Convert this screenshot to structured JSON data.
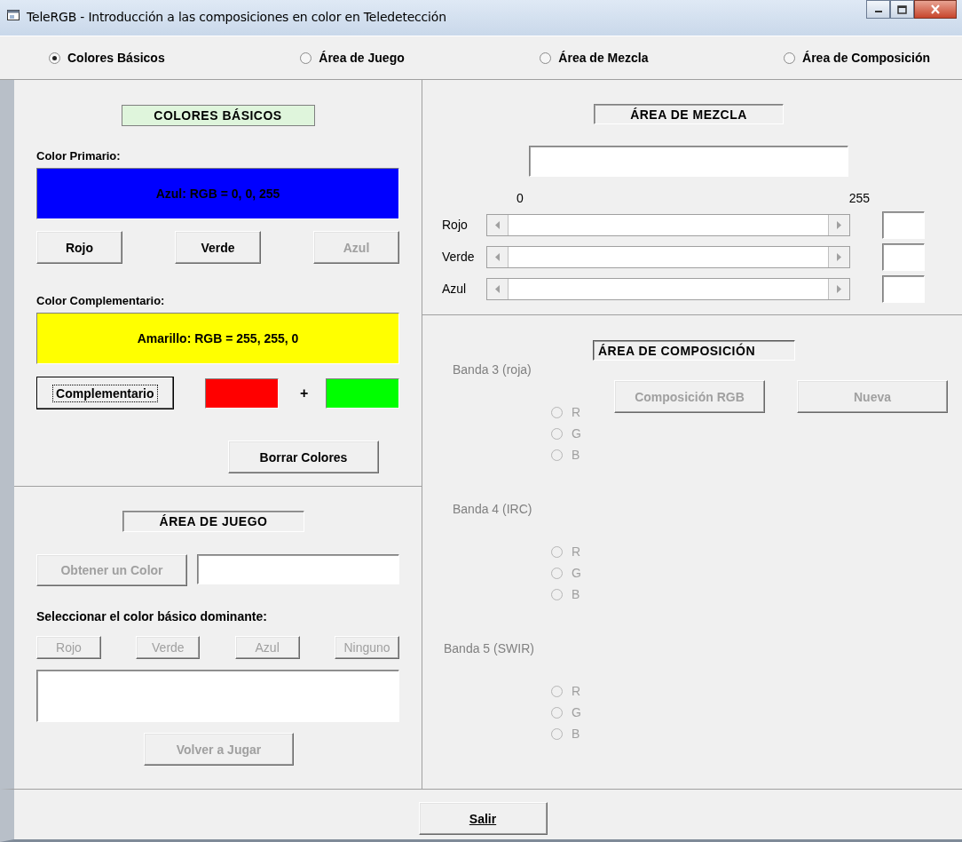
{
  "window": {
    "title": "TeleRGB - Introducción a las composiciones en color en Teledetección"
  },
  "modes": [
    {
      "label": "Colores Básicos",
      "selected": true
    },
    {
      "label": "Área de Juego",
      "selected": false
    },
    {
      "label": "Área de Mezcla",
      "selected": false
    },
    {
      "label": "Área de Composición",
      "selected": false
    }
  ],
  "basic_colors": {
    "heading": {
      "text": "COLORES BÁSICOS",
      "active": true
    },
    "primary_label": "Color Primario:",
    "primary": {
      "text": "Azul: RGB = 0, 0, 255",
      "color": "#0000ff"
    },
    "buttons": [
      {
        "label": "Rojo",
        "disabled": false
      },
      {
        "label": "Verde",
        "disabled": false
      },
      {
        "label": "Azul",
        "disabled": true
      }
    ],
    "complementary_label": "Color Complementario:",
    "complementary": {
      "text": "Amarillo: RGB = 255, 255, 0",
      "color": "#ffff00"
    },
    "complement_button": {
      "label": "Complementario",
      "focused": true
    },
    "mix_swatches": [
      {
        "color": "#ff0000"
      },
      {
        "color": "#00ff00"
      }
    ],
    "plus": "+",
    "clear_button": {
      "label": "Borrar Colores",
      "disabled": false
    }
  },
  "game_area": {
    "heading": {
      "text": "ÁREA DE JUEGO",
      "active": false
    },
    "get_color_button": {
      "label": "Obtener un Color",
      "disabled": true
    },
    "prompt": "Seleccionar el color básico dominante:",
    "choices": [
      {
        "label": "Rojo",
        "disabled": true
      },
      {
        "label": "Verde",
        "disabled": true
      },
      {
        "label": "Azul",
        "disabled": true
      },
      {
        "label": "Ninguno",
        "disabled": true
      }
    ],
    "replay_button": {
      "label": "Volver a Jugar",
      "disabled": true
    }
  },
  "mix_area": {
    "heading": {
      "text": "ÁREA DE MEZCLA",
      "active": false
    },
    "scale_min": "0",
    "scale_max": "255",
    "sliders": [
      {
        "name": "Rojo"
      },
      {
        "name": "Verde"
      },
      {
        "name": "Azul"
      }
    ]
  },
  "composition_area": {
    "heading": {
      "text": "ÁREA DE COMPOSICIÓN",
      "active": false
    },
    "buttons": [
      {
        "label": "Composición RGB",
        "disabled": true
      },
      {
        "label": "Nueva",
        "disabled": true
      }
    ],
    "bands": [
      {
        "name": "Banda 3 (roja)",
        "options": [
          {
            "label": "R",
            "selected": false,
            "disabled": true
          },
          {
            "label": "G",
            "selected": false,
            "disabled": true
          },
          {
            "label": "B",
            "selected": false,
            "disabled": true
          }
        ]
      },
      {
        "name": "Banda 4 (IRC)",
        "options": [
          {
            "label": "R",
            "selected": false,
            "disabled": true
          },
          {
            "label": "G",
            "selected": false,
            "disabled": true
          },
          {
            "label": "B",
            "selected": false,
            "disabled": true
          }
        ]
      },
      {
        "name": "Banda 5 (SWIR)",
        "options": [
          {
            "label": "R",
            "selected": false,
            "disabled": true
          },
          {
            "label": "G",
            "selected": false,
            "disabled": true
          },
          {
            "label": "B",
            "selected": false,
            "disabled": true
          }
        ]
      }
    ]
  },
  "exit_button": {
    "label": "Salir",
    "disabled": false
  }
}
